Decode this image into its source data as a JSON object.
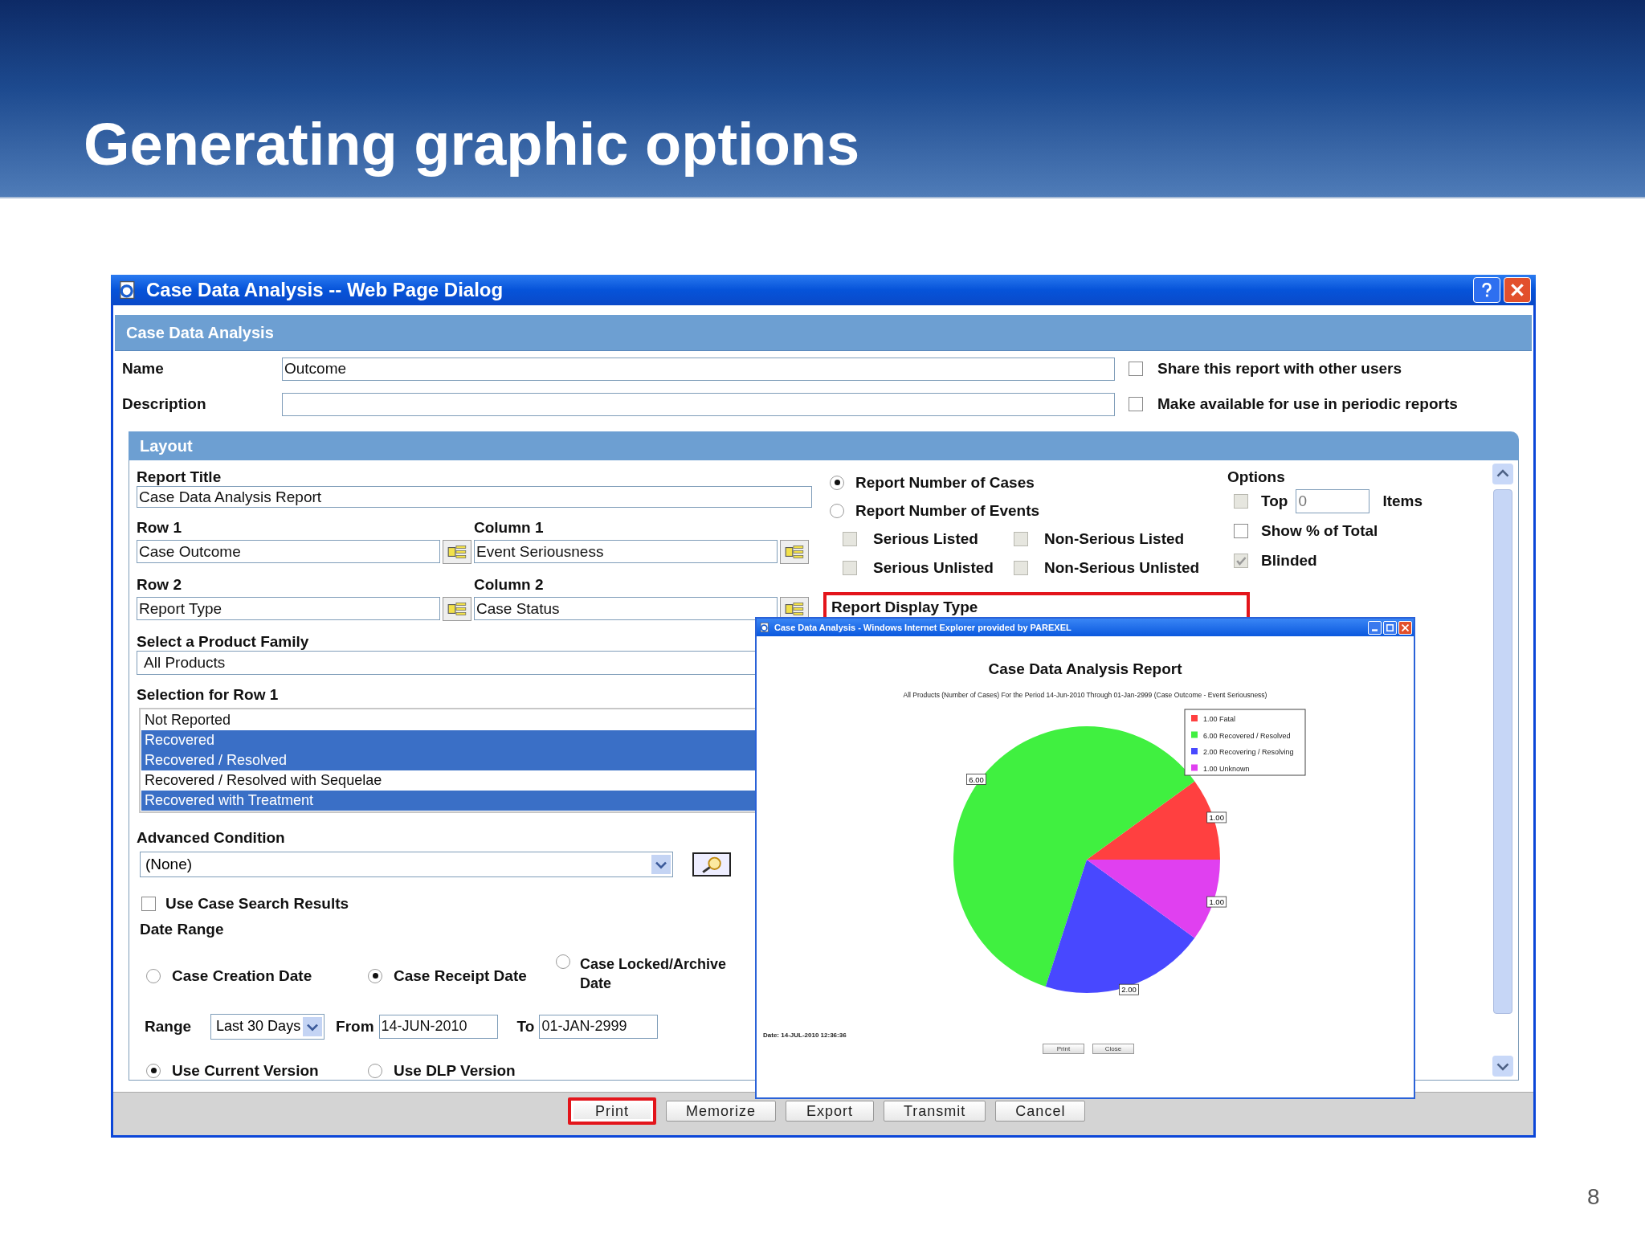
{
  "slide": {
    "title": "Generating graphic options",
    "page_number": "8"
  },
  "dialog": {
    "title": "Case Data Analysis -- Web Page Dialog",
    "section": "Case Data Analysis",
    "fields": [
      {
        "label": "Name",
        "value": "Outcome"
      },
      {
        "label": "Description"
      }
    ],
    "sharing": [
      {
        "label": "Share this report with other users",
        "checked": false
      },
      {
        "label": "Make available for use in periodic reports",
        "checked": false
      }
    ],
    "layout": {
      "title": "Layout",
      "report_title": {
        "label": "Report Title",
        "value": "Case Data Analysis Report"
      },
      "pickers": [
        {
          "label": "Row 1",
          "value": "Case Outcome"
        },
        {
          "label": "Column 1",
          "value": "Event Seriousness"
        },
        {
          "label": "Row 2",
          "value": "Report Type"
        },
        {
          "label": "Column 2",
          "value": "Case Status"
        }
      ],
      "product_family": {
        "label": "Select a Product Family",
        "value": "All Products"
      },
      "selection": {
        "label": "Selection for Row 1",
        "items": [
          {
            "label": "Not Reported",
            "selected": false
          },
          {
            "label": "Recovered",
            "selected": true
          },
          {
            "label": "Recovered / Resolved",
            "selected": true
          },
          {
            "label": "Recovered / Resolved with Sequelae",
            "selected": false
          },
          {
            "label": "Recovered with Treatment",
            "selected": true
          }
        ]
      },
      "advanced_condition": {
        "label": "Advanced Condition",
        "value": "(None)"
      },
      "use_case_search": {
        "label": "Use Case Search Results",
        "checked": false
      },
      "date_range": {
        "label": "Date Range",
        "options": [
          {
            "label": "Case Creation Date",
            "selected": false
          },
          {
            "label": "Case Receipt Date",
            "selected": true
          },
          {
            "label": "Case Locked/Archive Date",
            "selected": false
          }
        ]
      },
      "range": {
        "label": "Range",
        "value": "Last 30 Days",
        "from_label": "From",
        "from": "14-JUN-2010",
        "to_label": "To",
        "to": "01-JAN-2999"
      },
      "versions": [
        {
          "label": "Use Current Version",
          "selected": true
        },
        {
          "label": "Use DLP Version",
          "selected": false
        }
      ],
      "report_number": [
        {
          "label": "Report Number of Cases",
          "selected": true
        },
        {
          "label": "Report Number of Events",
          "selected": false
        }
      ],
      "seriousness": [
        {
          "label": "Serious Listed",
          "checked": false
        },
        {
          "label": "Non-Serious Listed",
          "checked": false
        },
        {
          "label": "Serious Unlisted",
          "checked": false
        },
        {
          "label": "Non-Serious Unlisted",
          "checked": false
        }
      ],
      "display_type": {
        "label": "Report Display Type",
        "highlighted": true
      },
      "options": {
        "title": "Options",
        "top": {
          "label": "Top",
          "checked": false,
          "placeholder": "0",
          "suffix": "Items"
        },
        "items": [
          {
            "label": "Show % of Total",
            "checked": false,
            "disabled": false
          },
          {
            "label": "Blinded",
            "checked": true,
            "disabled": true
          }
        ]
      }
    },
    "buttons": [
      {
        "label": "Print",
        "highlighted": true
      },
      {
        "label": "Memorize",
        "highlighted": false
      },
      {
        "label": "Export",
        "highlighted": false
      },
      {
        "label": "Transmit",
        "highlighted": false
      },
      {
        "label": "Cancel",
        "highlighted": false
      }
    ]
  },
  "popup": {
    "title": "Case Data Analysis - Windows Internet Explorer provided by PAREXEL",
    "report_title": "Case Data Analysis Report",
    "subtitle": "All Products (Number of Cases) For the Period 14-Jun-2010 Through 01-Jan-2999 (Case Outcome - Event Seriousness)",
    "chart_data": {
      "type": "pie",
      "categories": [
        "1.00 Fatal",
        "6.00 Recovered / Resolved",
        "2.00 Recovering / Resolving",
        "1.00 Unknown"
      ],
      "values": [
        1,
        6,
        2,
        1
      ],
      "colors": [
        "#ff4040",
        "#40f040",
        "#4848ff",
        "#e040f0"
      ],
      "value_labels": [
        "1.00",
        "6.00",
        "2.00",
        "1.00"
      ],
      "legend": "upper right"
    },
    "date": "Date: 14-JUL-2010 12:36:36",
    "buttons": [
      "Print",
      "Close"
    ]
  }
}
